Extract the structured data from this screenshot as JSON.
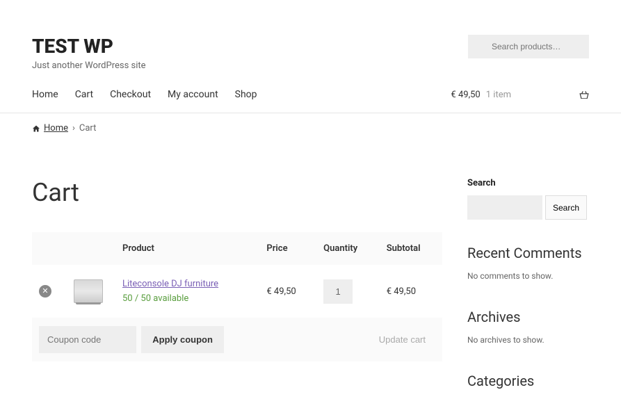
{
  "site": {
    "title": "TEST WP",
    "tagline": "Just another WordPress site"
  },
  "search": {
    "placeholder": "Search products…"
  },
  "nav": {
    "home": "Home",
    "cart": "Cart",
    "checkout": "Checkout",
    "account": "My account",
    "shop": "Shop"
  },
  "header_cart": {
    "total": "€ 49,50",
    "items": "1 item"
  },
  "breadcrumb": {
    "home": "Home",
    "sep": "›",
    "current": "Cart"
  },
  "page": {
    "title": "Cart"
  },
  "table": {
    "headers": {
      "product": "Product",
      "price": "Price",
      "quantity": "Quantity",
      "subtotal": "Subtotal"
    },
    "rows": [
      {
        "name": "Liteconsole DJ furniture",
        "availability": "50 / 50 available",
        "price": "€ 49,50",
        "qty": "1",
        "subtotal": "€ 49,50"
      }
    ],
    "coupon_placeholder": "Coupon code",
    "apply": "Apply coupon",
    "update": "Update cart"
  },
  "sidebar": {
    "search_label": "Search",
    "search_btn": "Search",
    "recent_title": "Recent Comments",
    "recent_text": "No comments to show.",
    "archives_title": "Archives",
    "archives_text": "No archives to show.",
    "categories_title": "Categories"
  }
}
